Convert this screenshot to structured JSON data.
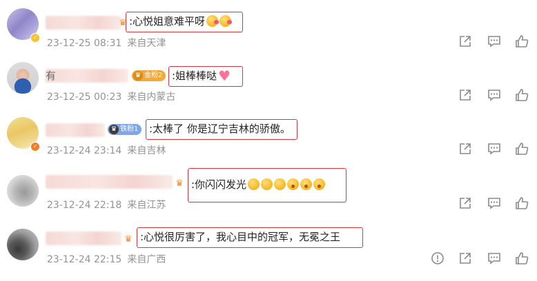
{
  "comments": [
    {
      "text": ":心悦姐意难平呀",
      "emojis": [
        "kiss",
        "kiss"
      ],
      "time": "23-12-25 08:31",
      "location": "来自天津"
    },
    {
      "name_prefix": "有",
      "fan_badge": "金粉2",
      "text": ":姐棒棒哒",
      "emojis": [
        "heart"
      ],
      "time": "23-12-25 00:23",
      "location": "来自内蒙古"
    },
    {
      "fan_badge": "铁粉1",
      "text": ":太棒了 你是辽宁吉林的骄傲。",
      "emojis": [],
      "time": "23-12-24 23:14",
      "location": "来自吉林"
    },
    {
      "text": ":你闪闪发光",
      "emojis": [
        "smile",
        "smile",
        "smile",
        "wow",
        "wow",
        "wow"
      ],
      "time": "23-12-24 22:18",
      "location": "来自江苏"
    },
    {
      "text": ":心悦很厉害了，我心目中的冠军，无冕之王",
      "emojis": [],
      "time": "23-12-24 22:15",
      "location": "来自广西"
    }
  ],
  "colors": {
    "highlight_border": "#d9363e",
    "meta_text": "#939393",
    "icon": "#8a8a8a",
    "gold_badge": "#f2a93b",
    "iron_badge": "#7fa7e6"
  },
  "icons": [
    "share-icon",
    "comment-icon",
    "like-icon",
    "report-icon"
  ]
}
